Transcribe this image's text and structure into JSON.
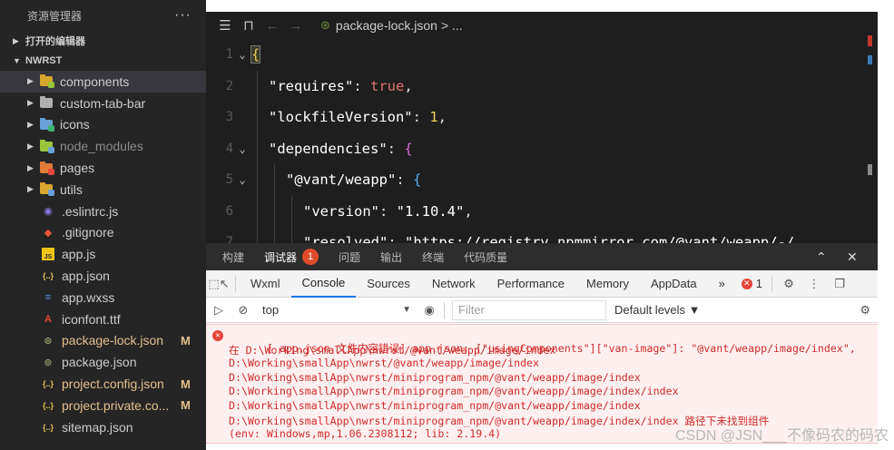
{
  "sidebar": {
    "title": "资源管理器",
    "more": "···",
    "open_editors": "打开的编辑器",
    "project": "NWRST",
    "items": [
      {
        "label": "components",
        "kind": "folder",
        "selected": true,
        "color": "#d9a62e",
        "dot": "#9bc53d"
      },
      {
        "label": "custom-tab-bar",
        "kind": "folder",
        "color": "#b0b0b0"
      },
      {
        "label": "icons",
        "kind": "folder",
        "color": "#6aa0d8",
        "dot": "#3cb371"
      },
      {
        "label": "node_modules",
        "kind": "folder",
        "dim": true,
        "color": "#9bc53d",
        "dot": "#6aa0d8"
      },
      {
        "label": "pages",
        "kind": "folder",
        "color": "#e07b39",
        "dot": "#e8453c"
      },
      {
        "label": "utils",
        "kind": "folder",
        "color": "#d9a62e",
        "dot": "#6aa0d8"
      },
      {
        "label": ".eslintrc.js",
        "kind": "file",
        "icon": "◉",
        "icon_color": "#8c7ae6"
      },
      {
        "label": ".gitignore",
        "kind": "file",
        "icon": "◆",
        "icon_color": "#e8553c"
      },
      {
        "label": "app.js",
        "kind": "file",
        "icon": "JS",
        "icon_color": "#f0c419"
      },
      {
        "label": "app.json",
        "kind": "file",
        "icon": "{..}",
        "icon_color": "#e0c050"
      },
      {
        "label": "app.wxss",
        "kind": "file",
        "icon": "≡",
        "icon_color": "#5a8fe0"
      },
      {
        "label": "iconfont.ttf",
        "kind": "file",
        "icon": "A",
        "icon_color": "#e8453c"
      },
      {
        "label": "package-lock.json",
        "kind": "file",
        "icon": "⊛",
        "icon_color": "#8a9a6a",
        "mod": true,
        "badge": "M"
      },
      {
        "label": "package.json",
        "kind": "file",
        "icon": "⊛",
        "icon_color": "#8a9a6a"
      },
      {
        "label": "project.config.json",
        "kind": "file",
        "icon": "{..}",
        "icon_color": "#e0c050",
        "mod": true,
        "badge": "M"
      },
      {
        "label": "project.private.co...",
        "kind": "file",
        "icon": "{..}",
        "icon_color": "#e0c050",
        "mod": true,
        "badge": "M"
      },
      {
        "label": "sitemap.json",
        "kind": "file",
        "icon": "{..}",
        "icon_color": "#e0c050"
      }
    ]
  },
  "editor": {
    "breadcrumb_file": "package-lock.json",
    "breadcrumb_tail": "> ...",
    "lines": [
      {
        "num": "1",
        "fold": "⌄"
      },
      {
        "num": "2",
        "key": "\"requires\"",
        "val": "true",
        "vtype": "bool"
      },
      {
        "num": "3",
        "key": "\"lockfileVersion\"",
        "val": "1",
        "vtype": "num"
      },
      {
        "num": "4",
        "key": "\"dependencies\"",
        "fold": "⌄"
      },
      {
        "num": "5",
        "key": "\"@vant/weapp\"",
        "fold": "⌄"
      },
      {
        "num": "6",
        "key": "\"version\"",
        "val": "\"1.10.4\"",
        "vtype": "str"
      },
      {
        "num": "7",
        "key": "\"resolved\"",
        "val": "\"https://registry.npmmirror.com/@vant/weapp/-/",
        "vtype": "str"
      }
    ]
  },
  "panel": {
    "tabs": [
      "构建",
      "调试器",
      "问题",
      "输出",
      "终端",
      "代码质量"
    ],
    "active_tab": "调试器",
    "debugger_count": "1",
    "collapse": "⌃",
    "close": "✕"
  },
  "devtools": {
    "tabs": [
      "Wxml",
      "Console",
      "Sources",
      "Network",
      "Performance",
      "Memory",
      "AppData"
    ],
    "active_tab": "Console",
    "more": "»",
    "error_count": "1",
    "context": "top",
    "filter_placeholder": "Filter",
    "levels": "Default levels ▼"
  },
  "console": {
    "lines": [
      "[ app.json 文件内容错误] app.json: [\"usingComponents\"][\"van-image\"]: \"@vant/weapp/image/index\",",
      "在 D:\\Working\\smallApp\\nwrst/@vant/weapp/image/index",
      "D:\\Working\\smallApp\\nwrst/@vant/weapp/image/index",
      "D:\\Working\\smallApp\\nwrst/miniprogram_npm/@vant/weapp/image/index",
      "D:\\Working\\smallApp\\nwrst/miniprogram_npm/@vant/weapp/image/index/index",
      "D:\\Working\\smallApp\\nwrst/miniprogram_npm/@vant/weapp/image/index",
      "D:\\Working\\smallApp\\nwrst/miniprogram_npm/@vant/weapp/image/index/index 路径下未找到组件",
      "(env: Windows,mp,1.06.2308112; lib: 2.19.4)"
    ]
  },
  "watermark": "CSDN @JSN___不像码农的码农"
}
